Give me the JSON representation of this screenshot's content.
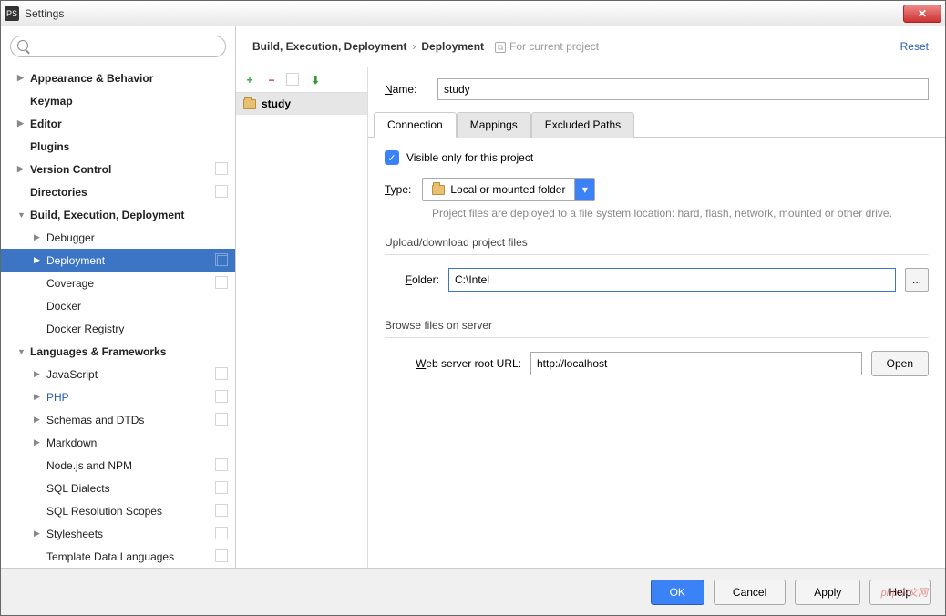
{
  "window": {
    "title": "Settings",
    "app_icon_text": "PS"
  },
  "search": {
    "placeholder": ""
  },
  "sidebar": {
    "items": [
      {
        "label": "Appearance & Behavior",
        "bold": true,
        "arrow": "▶",
        "level": 0,
        "copy": false
      },
      {
        "label": "Keymap",
        "bold": true,
        "level": 0
      },
      {
        "label": "Editor",
        "bold": true,
        "arrow": "▶",
        "level": 0
      },
      {
        "label": "Plugins",
        "bold": true,
        "level": 0
      },
      {
        "label": "Version Control",
        "bold": true,
        "arrow": "▶",
        "level": 0,
        "copy": true
      },
      {
        "label": "Directories",
        "bold": true,
        "level": 0,
        "copy": true
      },
      {
        "label": "Build, Execution, Deployment",
        "bold": true,
        "arrow": "▼",
        "level": 0
      },
      {
        "label": "Debugger",
        "arrow": "▶",
        "level": 1
      },
      {
        "label": "Deployment",
        "arrow": "▶",
        "level": 1,
        "sel": true,
        "copy": true
      },
      {
        "label": "Coverage",
        "level": 1,
        "copy": true
      },
      {
        "label": "Docker",
        "level": 1
      },
      {
        "label": "Docker Registry",
        "level": 1
      },
      {
        "label": "Languages & Frameworks",
        "bold": true,
        "arrow": "▼",
        "level": 0
      },
      {
        "label": "JavaScript",
        "arrow": "▶",
        "level": 1,
        "copy": true
      },
      {
        "label": "PHP",
        "arrow": "▶",
        "level": 1,
        "copy": true,
        "php": true
      },
      {
        "label": "Schemas and DTDs",
        "arrow": "▶",
        "level": 1,
        "copy": true
      },
      {
        "label": "Markdown",
        "arrow": "▶",
        "level": 1
      },
      {
        "label": "Node.js and NPM",
        "level": 1,
        "copy": true
      },
      {
        "label": "SQL Dialects",
        "level": 1,
        "copy": true
      },
      {
        "label": "SQL Resolution Scopes",
        "level": 1,
        "copy": true
      },
      {
        "label": "Stylesheets",
        "arrow": "▶",
        "level": 1,
        "copy": true
      },
      {
        "label": "Template Data Languages",
        "level": 1,
        "copy": true
      }
    ]
  },
  "breadcrumb": {
    "root": "Build, Execution, Deployment",
    "leaf": "Deployment",
    "hint": "For current project",
    "reset": "Reset"
  },
  "toolbar": {
    "add": "+",
    "remove": "−"
  },
  "list": {
    "selected": "study"
  },
  "form": {
    "name_label": "Name:",
    "name_value": "study",
    "tabs": [
      "Connection",
      "Mappings",
      "Excluded Paths"
    ],
    "visible_only": "Visible only for this project",
    "type_label": "Type:",
    "type_value": "Local or mounted folder",
    "type_desc": "Project files are deployed to a file system location: hard, flash, network, mounted or other drive.",
    "upload_section": "Upload/download project files",
    "folder_label": "Folder:",
    "folder_value": "C:\\Intel",
    "browse_section": "Browse files on server",
    "url_label": "Web server root URL:",
    "url_value": "http://localhost",
    "open": "Open",
    "ellipsis": "..."
  },
  "footer": {
    "ok": "OK",
    "cancel": "Cancel",
    "apply": "Apply",
    "help": "Help"
  },
  "watermark": "php中文网"
}
